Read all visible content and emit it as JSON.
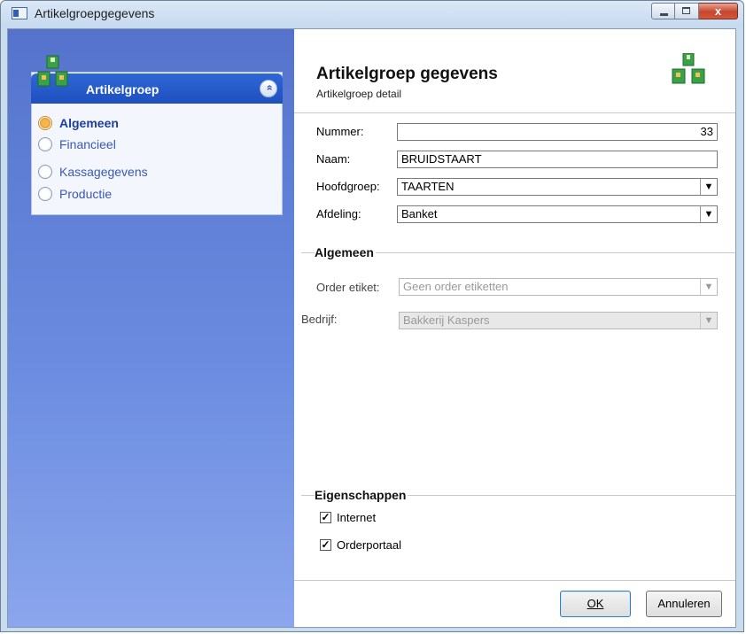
{
  "window": {
    "title": "Artikelgroepgegevens",
    "close_glyph": "x"
  },
  "sidebar": {
    "panel_title": "Artikelgroep",
    "collapse_glyph": "»",
    "items": [
      {
        "label": "Algemeen",
        "selected": true
      },
      {
        "label": "Financieel",
        "selected": false
      },
      {
        "label": "Kassagegevens",
        "selected": false
      },
      {
        "label": "Productie",
        "selected": false
      }
    ]
  },
  "header": {
    "title": "Artikelgroep gegevens",
    "subtitle": "Artikelgroep detail"
  },
  "form": {
    "nummer_label": "Nummer:",
    "nummer_value": "33",
    "naam_label": "Naam:",
    "naam_value": "BRUIDSTAART",
    "hoofdgroep_label": "Hoofdgroep:",
    "hoofdgroep_value": "TAARTEN",
    "afdeling_label": "Afdeling:",
    "afdeling_value": "Banket"
  },
  "algemeen": {
    "title": "Algemeen",
    "order_etiket_label": "Order etiket:",
    "order_etiket_value": "Geen order etiketten",
    "bedrijf_label": "Bedrijf:",
    "bedrijf_value": "Bakkerij Kaspers"
  },
  "eigenschappen": {
    "title": "Eigenschappen",
    "internet_label": "Internet",
    "internet_checked": true,
    "orderportaal_label": "Orderportaal",
    "orderportaal_checked": true
  },
  "buttons": {
    "ok": "OK",
    "cancel": "Annuleren"
  },
  "colors": {
    "sidebar_top": "#5573cc",
    "panel_header": "#2f67d6",
    "nav_link": "#3a58b8"
  }
}
